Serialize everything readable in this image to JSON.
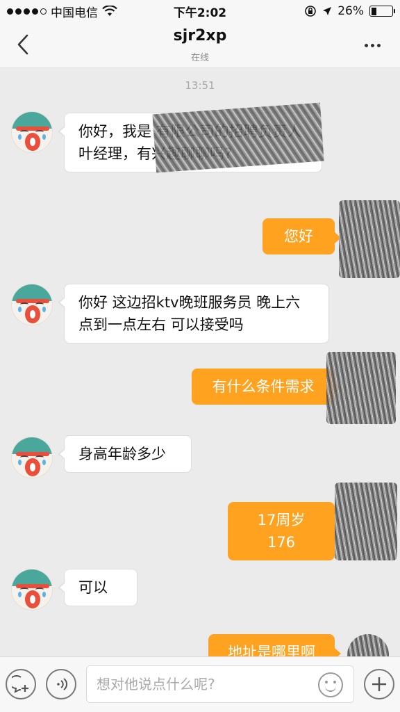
{
  "status_bar": {
    "carrier": "中国电信",
    "time": "下午2:02",
    "battery": "26%",
    "battery_level": 0.26
  },
  "nav": {
    "title": "sjr2xp",
    "subtitle": "在线"
  },
  "chat": {
    "timestamp": "13:51",
    "messages": [
      {
        "side": "in",
        "text": "你好，我是  有限公司的招聘负责人叶经理，有兴趣聊聊吗?"
      },
      {
        "side": "out",
        "text": "您好"
      },
      {
        "side": "in",
        "text": "你好 这边招ktv晚班服务员   晚上六点到一点左右  可以接受吗"
      },
      {
        "side": "out",
        "text": "有什么条件需求"
      },
      {
        "side": "in",
        "text": "身高年龄多少"
      },
      {
        "side": "out",
        "text": "17周岁 176"
      },
      {
        "side": "in",
        "text": "可以"
      },
      {
        "side": "out",
        "text": "地址是哪里啊"
      }
    ]
  },
  "input_bar": {
    "placeholder": "想对他说点什么呢?"
  },
  "colors": {
    "outgoing_bubble": "#ffa21f",
    "incoming_bubble": "#ffffff",
    "background": "#ebebeb"
  }
}
